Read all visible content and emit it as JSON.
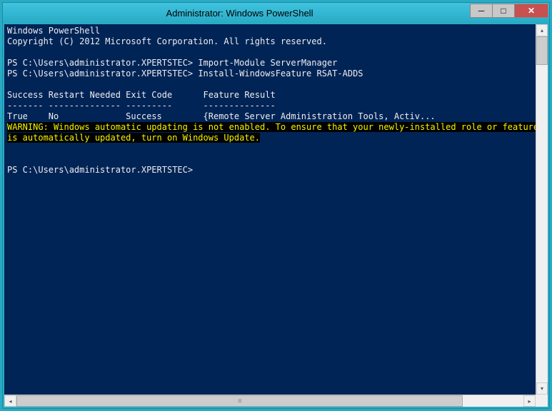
{
  "window": {
    "title": "Administrator: Windows PowerShell"
  },
  "console": {
    "header1": "Windows PowerShell",
    "header2": "Copyright (C) 2012 Microsoft Corporation. All rights reserved.",
    "blank": "",
    "prompt_path": "PS C:\\Users\\administrator.XPERTSTEC>",
    "cmd1": "Import-Module ServerManager",
    "cmd2": "Install-WindowsFeature RSAT-ADDS",
    "table_header": "Success Restart Needed Exit Code      Feature Result",
    "table_sep": "------- -------------- ---------      --------------",
    "table_row": "True    No             Success        {Remote Server Administration Tools, Activ...",
    "warning": "WARNING: Windows automatic updating is not enabled. To ensure that your newly-installed role or feature\nis automatically updated, turn on Windows Update."
  },
  "controls": {
    "minimize": "─",
    "maximize": "□",
    "close": "✕",
    "scroll_up": "▴",
    "scroll_down": "▾",
    "scroll_left": "◂",
    "scroll_right": "▸",
    "grip": "≡"
  }
}
